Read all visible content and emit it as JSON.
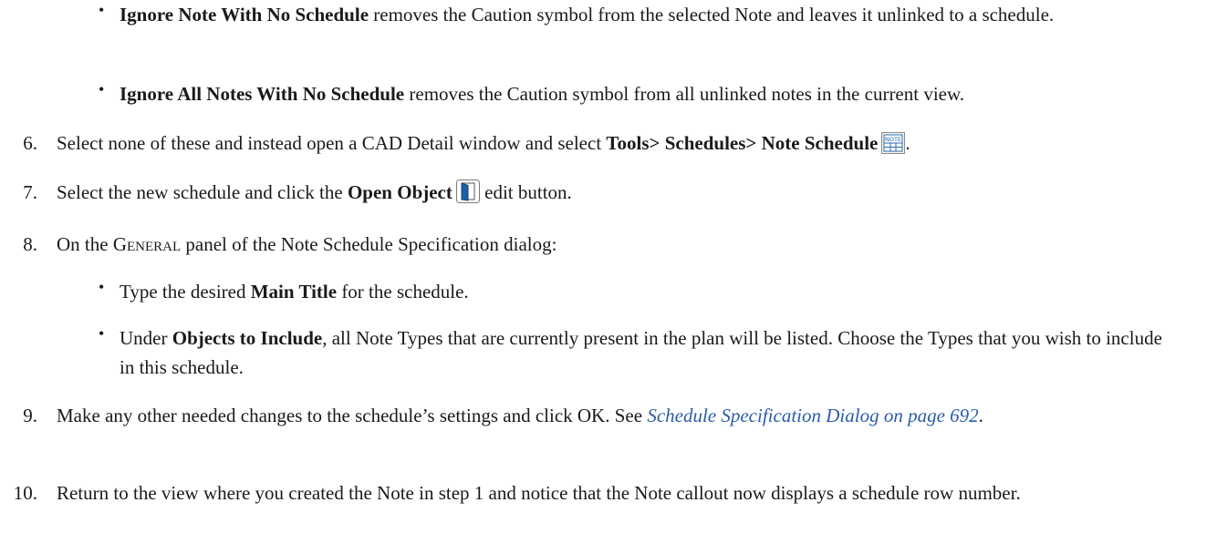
{
  "bullets_top": [
    {
      "bold": "Ignore Note With No Schedule",
      "text": " removes the Caution symbol from the selected Note and leaves it unlinked to a schedule."
    },
    {
      "bold": "Ignore All Notes With No Schedule",
      "text": " removes the Caution symbol from all unlinked notes in the current view."
    }
  ],
  "step6": {
    "num": "6.",
    "pre": "Select none of these and instead open a CAD Detail window and select ",
    "bold": "Tools> Schedules> Note Schedule",
    "post": ".",
    "icon": "note-schedule-icon",
    "icon_label": "NOTE"
  },
  "step7": {
    "num": "7.",
    "pre": "Select the new schedule and click the ",
    "bold": "Open Object",
    "post": " edit button.",
    "icon": "open-object-icon"
  },
  "step8": {
    "num": "8.",
    "pre": "On the ",
    "smallcaps": "General",
    "post": " panel of the Note Schedule Specification dialog:"
  },
  "bullets_step8": [
    {
      "pre": "Type the desired ",
      "bold": "Main Title",
      "post": " for the schedule."
    },
    {
      "pre": "Under ",
      "bold": "Objects to Include",
      "post": ", all Note Types that are currently present in the plan will be listed. Choose the Types that you wish to include in this schedule."
    }
  ],
  "step9": {
    "num": "9.",
    "pre": "Make any other needed changes to the schedule’s settings and click OK. See ",
    "link": "Schedule Specification Dialog on page 692",
    "post": "."
  },
  "step10": {
    "num": "10.",
    "text": "Return to the view where you created the Note in step 1 and notice that the Note callout now displays a schedule row number."
  },
  "colors": {
    "link": "#2a5caa",
    "icon_blue": "#2b6cb0"
  }
}
